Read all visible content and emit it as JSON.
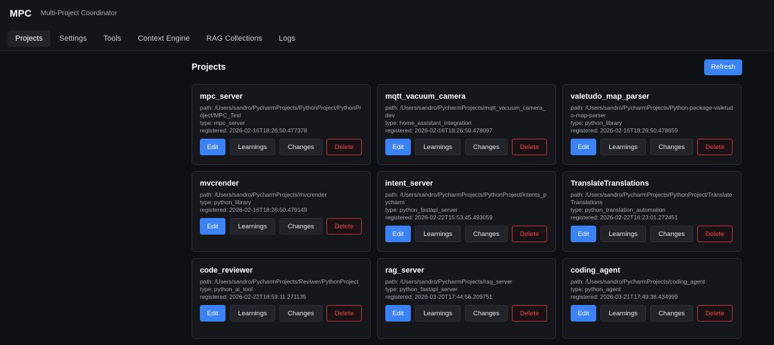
{
  "app": {
    "title": "MPC",
    "subtitle": "Multi-Project Coordinator"
  },
  "nav": {
    "tabs": [
      "Projects",
      "Settings",
      "Tools",
      "Context Engine",
      "RAG Collections",
      "Logs"
    ],
    "active": "Projects"
  },
  "main": {
    "title": "Projects",
    "refresh_label": "Refresh"
  },
  "buttons": {
    "edit": "Edit",
    "learnings": "Learnings",
    "changes": "Changes",
    "delete": "Delete"
  },
  "colors": {
    "accent": "#3b82f6",
    "danger": "#ef4444",
    "background": "#0f1014",
    "card": "#16171b"
  },
  "projects": [
    {
      "name": "mpc_server",
      "path": "path: /Users/sandro/PycharmProjects/PythonProject/PythonProject/MPC_Test",
      "type": "type: mpc_server",
      "registered": "registered: 2026-02-16T18:26:50.477378"
    },
    {
      "name": "mqtt_vacuum_camera",
      "path": "path: /Users/sandro/PycharmProjects/mqtt_vacuum_camera_dev",
      "type": "type: home_assistant_integration",
      "registered": "registered: 2026-02-16T18:26:50.478097"
    },
    {
      "name": "valetudo_map_parser",
      "path": "path: /Users/sandro/PycharmProjects/Python-package-valetudo-map-parser",
      "type": "type: python_library",
      "registered": "registered: 2026-02-16T18:26:50.478659"
    },
    {
      "name": "mvcrender",
      "path": "path: /Users/sandro/PycharmProjects/mvcrender",
      "type": "type: python_library",
      "registered": "registered: 2026-02-16T18:26:50.479149"
    },
    {
      "name": "intent_server",
      "path": "path: /Users/sandro/PycharmProjects/PythonProject/intents_pycharm",
      "type": "type: python_fastapi_server",
      "registered": "registered: 2026-02-22T15:53:45.493059"
    },
    {
      "name": "TranslateTranslations",
      "path": "path: /Users/sandro/PycharmProjects/PythonProject/TranslateTranslations",
      "type": "type: python_translation_automation",
      "registered": "registered: 2026-02-22T16:23:01.272451"
    },
    {
      "name": "code_reviewer",
      "path": "path: /Users/sandro/PycharmProjects/Reviwer/PythonProject",
      "type": "type: python_ai_tool",
      "registered": "registered: 2026-02-22T18:59:11.271135"
    },
    {
      "name": "rag_server",
      "path": "path: /Users/sandro/PycharmProjects/rag_server",
      "type": "type: python_fastapi_server",
      "registered": "registered: 2026-03-20T17:44:56.209751"
    },
    {
      "name": "coding_agent",
      "path": "path: /Users/sandro/PycharmProjects/coding_agent",
      "type": "type: python_agent",
      "registered": "registered: 2026-03-21T17:49:38.434999"
    }
  ]
}
